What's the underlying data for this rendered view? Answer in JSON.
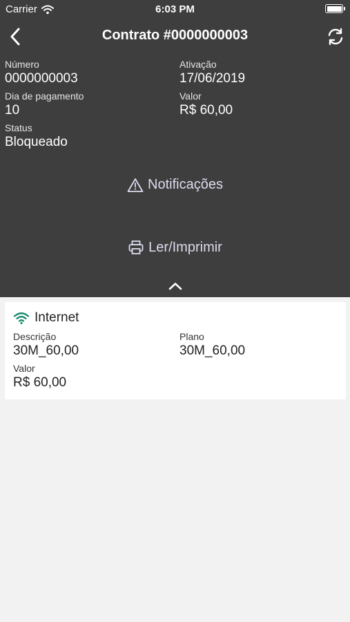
{
  "status_bar": {
    "carrier": "Carrier",
    "time": "6:03 PM"
  },
  "nav": {
    "title": "Contrato #0000000003"
  },
  "details": {
    "numero_label": "Número",
    "numero_value": "0000000003",
    "ativacao_label": "Ativação",
    "ativacao_value": "17/06/2019",
    "dia_label": "Dia de pagamento",
    "dia_value": "10",
    "valor_label": "Valor",
    "valor_value": "R$ 60,00",
    "status_label": "Status",
    "status_value": "Bloqueado"
  },
  "actions": {
    "notificacoes": "Notificações",
    "imprimir": "Ler/Imprimir"
  },
  "service": {
    "title": "Internet",
    "icon_color": "#1a8a6e",
    "descricao_label": "Descrição",
    "descricao_value": "30M_60,00",
    "plano_label": "Plano",
    "plano_value": "30M_60,00",
    "valor_label": "Valor",
    "valor_value": "R$ 60,00"
  },
  "colors": {
    "header_bg": "#3e3e3e",
    "page_bg": "#f2f2f2",
    "action_text": "#dcdcf0"
  }
}
